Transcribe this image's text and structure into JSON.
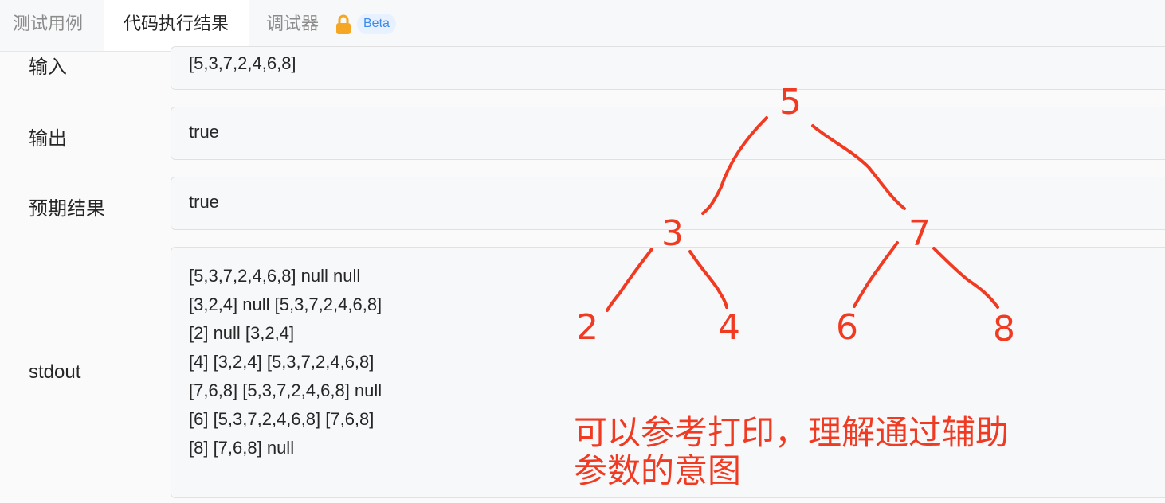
{
  "tabs": {
    "test_cases": "测试用例",
    "execution_result": "代码执行结果",
    "debugger": "调试器",
    "beta": "Beta"
  },
  "rows": {
    "input": {
      "label": "输入",
      "value": "[5,3,7,2,4,6,8]"
    },
    "output": {
      "label": "输出",
      "value": "true"
    },
    "expected": {
      "label": "预期结果",
      "value": "true"
    },
    "stdout": {
      "label": "stdout",
      "lines": [
        "[5,3,7,2,4,6,8] null null",
        "[3,2,4] null [5,3,7,2,4,6,8]",
        "[2] null [3,2,4]",
        "[4] [3,2,4] [5,3,7,2,4,6,8]",
        "[7,6,8] [5,3,7,2,4,6,8] null",
        "[6] [5,3,7,2,4,6,8] [7,6,8]",
        "[8] [7,6,8] null"
      ]
    }
  },
  "annotation": {
    "color": "#f13a22",
    "tree_nodes": [
      "5",
      "3",
      "7",
      "2",
      "4",
      "6",
      "8"
    ],
    "note_lines": [
      "可以参考打印，理解通过辅助",
      "参数的意图"
    ]
  },
  "icons": {
    "lock": "lock-icon"
  }
}
